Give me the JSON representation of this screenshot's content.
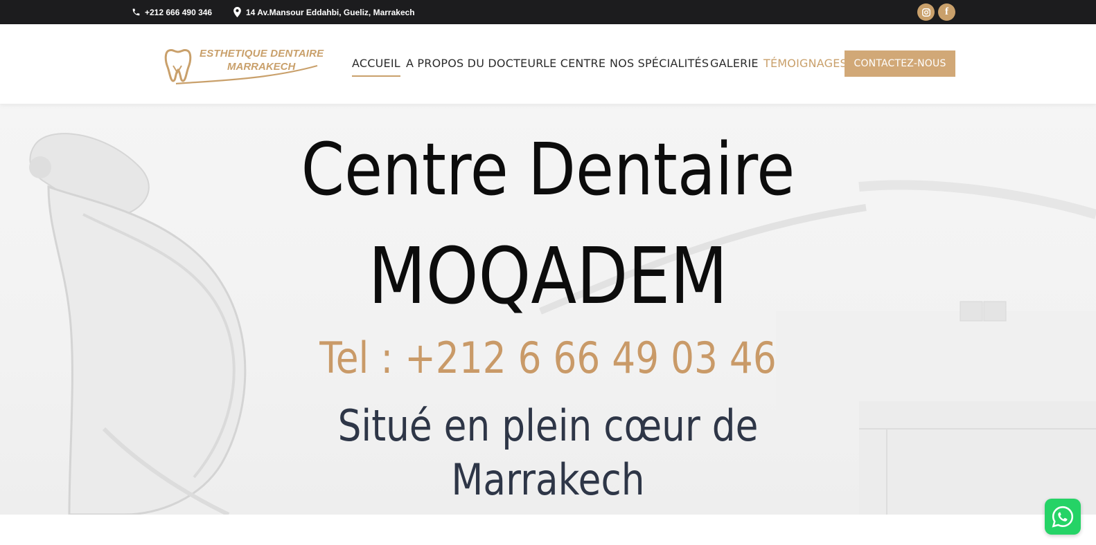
{
  "topbar": {
    "phone": "+212 666 490 346",
    "address": "14 Av.Mansour Eddahbi, Gueliz, Marrakech",
    "social": [
      {
        "name": "instagram-icon"
      },
      {
        "name": "facebook-icon",
        "glyph": "f"
      }
    ]
  },
  "header": {
    "logo_line1": "ESTHETIQUE DENTAIRE",
    "logo_line2": "MARRAKECH",
    "nav": [
      {
        "label": "ACCUEIL",
        "state": "active"
      },
      {
        "label": "A PROPOS DU DOCTEUR"
      },
      {
        "label": "LE CENTRE"
      },
      {
        "label": "NOS SPÉCIALITÉS"
      },
      {
        "label": "GALERIE"
      },
      {
        "label": "TÉMOIGNAGES",
        "state": "highlight"
      }
    ],
    "cta_label": "CONTACTEZ-NOUS"
  },
  "hero": {
    "title_line1": "Centre Dentaire",
    "title_line2": "MOQADEM",
    "tel": "Tel : +212 6 66 49 03 46",
    "subtitle_line1": "Situé en plein cœur de",
    "subtitle_line2": "Marrakech"
  },
  "colors": {
    "accent": "#c9a06b",
    "topbar": "#1c1c1e",
    "title": "#0c0c0c",
    "subtitle": "#2e3647",
    "whatsapp": "#25d366"
  }
}
